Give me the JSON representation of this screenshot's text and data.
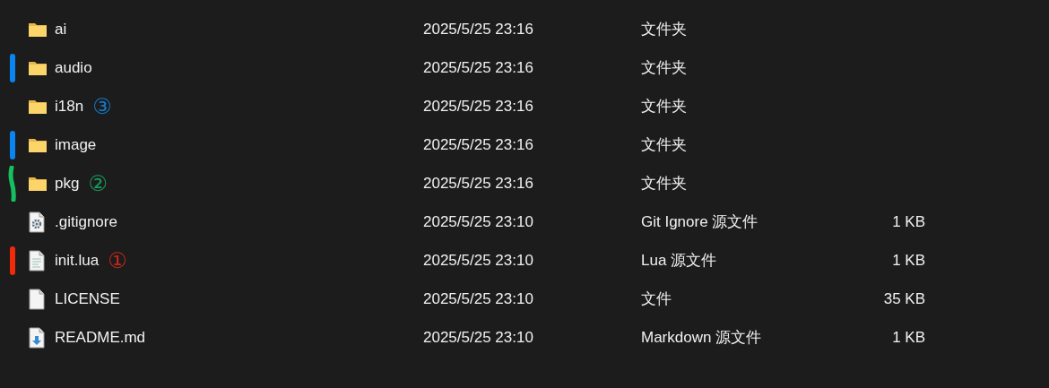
{
  "rows": [
    {
      "kind": "folder",
      "name": "ai",
      "modified": "2025/5/25 23:16",
      "type": "文件夹"
    },
    {
      "kind": "folder",
      "name": "audio",
      "modified": "2025/5/25 23:16",
      "type": "文件夹",
      "mark": {
        "kind": "bar",
        "color": "#0a84f0"
      }
    },
    {
      "kind": "folder",
      "name": "i18n",
      "modified": "2025/5/25 23:16",
      "type": "文件夹",
      "badge": {
        "text": "③",
        "color": "#1479c8"
      }
    },
    {
      "kind": "folder",
      "name": "image",
      "modified": "2025/5/25 23:16",
      "type": "文件夹",
      "mark": {
        "kind": "bar",
        "color": "#0a84f0"
      }
    },
    {
      "kind": "folder",
      "name": "pkg",
      "modified": "2025/5/25 23:16",
      "type": "文件夹",
      "mark": {
        "kind": "wave",
        "color": "#16c060"
      },
      "badge": {
        "text": "②",
        "color": "#1a9a5a"
      }
    },
    {
      "kind": "settings",
      "name": ".gitignore",
      "modified": "2025/5/25 23:10",
      "type": "Git Ignore 源文件",
      "size": "1 KB"
    },
    {
      "kind": "text",
      "name": "init.lua",
      "modified": "2025/5/25 23:10",
      "type": "Lua 源文件",
      "size": "1 KB",
      "mark": {
        "kind": "bar",
        "color": "#f02a0a"
      },
      "badge": {
        "text": "①",
        "color": "#c0281c"
      }
    },
    {
      "kind": "blank",
      "name": "LICENSE",
      "modified": "2025/5/25 23:10",
      "type": "文件",
      "size": "35 KB"
    },
    {
      "kind": "download",
      "name": "README.md",
      "modified": "2025/5/25 23:10",
      "type": "Markdown 源文件",
      "size": "1 KB"
    }
  ]
}
